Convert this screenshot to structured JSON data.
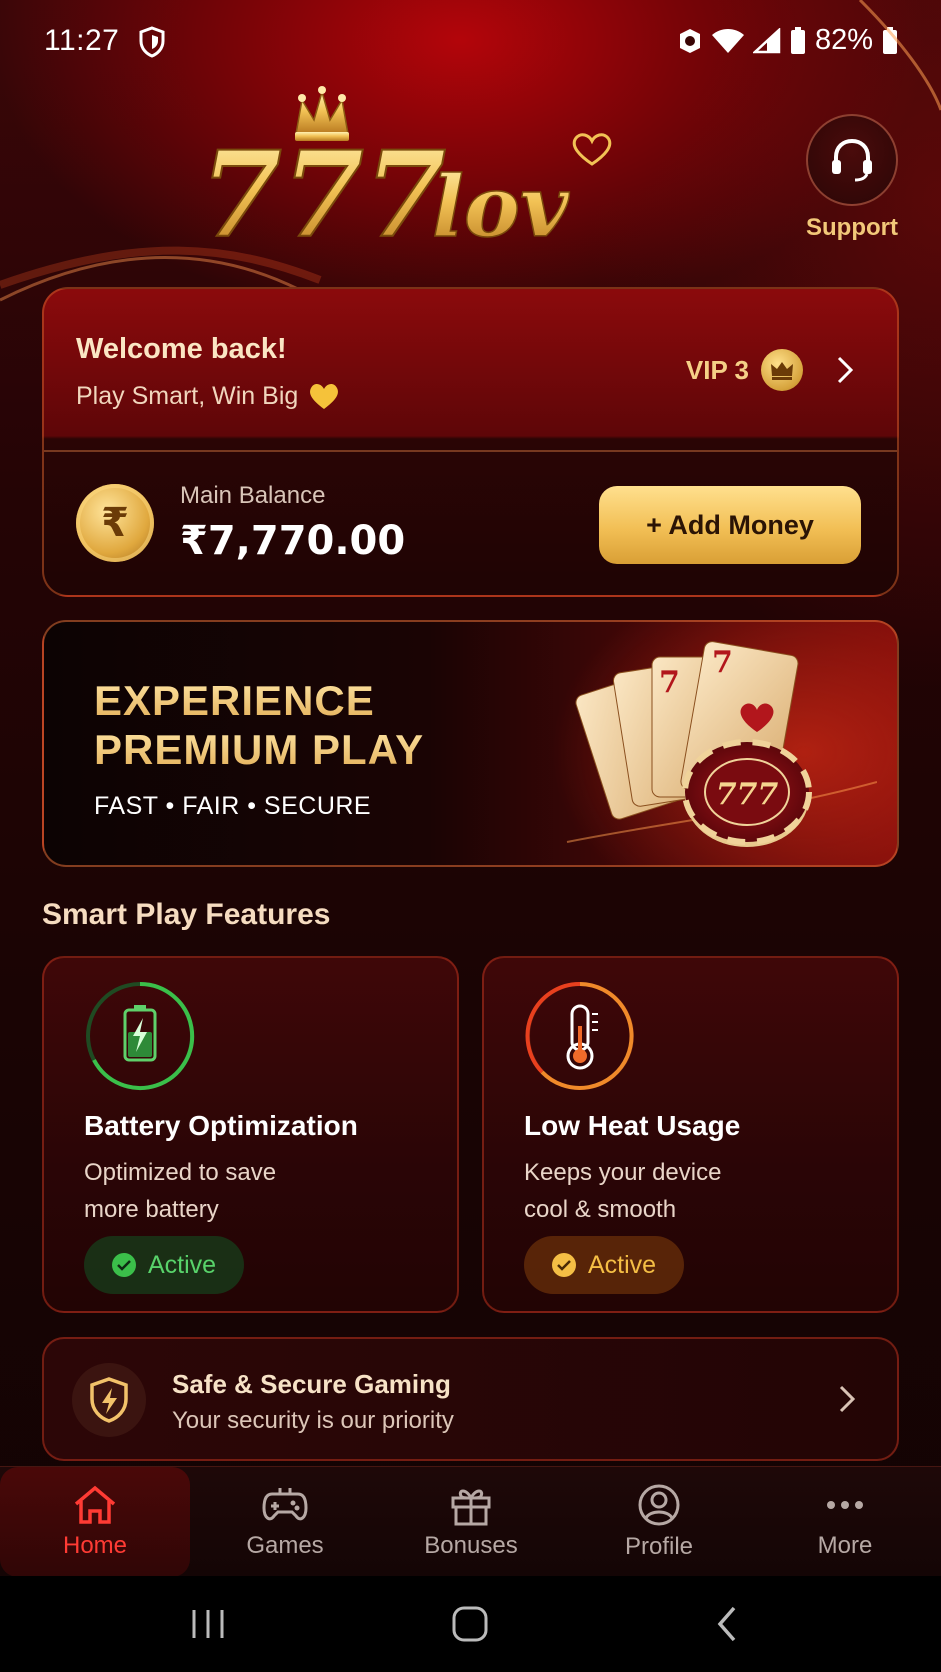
{
  "status_bar": {
    "time": "11:27",
    "battery": "82%"
  },
  "brand": {
    "logo_numbers": "777",
    "logo_word": "lov"
  },
  "support": {
    "label": "Support"
  },
  "welcome": {
    "title": "Welcome back!",
    "subtitle": "Play Smart, Win Big",
    "vip_label": "VIP 3"
  },
  "balance": {
    "label": "Main Balance",
    "value": "₹7,770.00",
    "currency_symbol": "₹",
    "add_money_label": "+ Add Money"
  },
  "banner": {
    "line1": "EXPERIENCE",
    "line2": "PREMIUM PLAY",
    "tagline": "FAST • FAIR • SECURE",
    "chip_text": "777"
  },
  "features": {
    "section_title": "Smart Play Features",
    "items": [
      {
        "title": "Battery Optimization",
        "desc_line1": "Optimized to save",
        "desc_line2": "more battery",
        "status": "Active",
        "icon": "battery-icon"
      },
      {
        "title": "Low Heat Usage",
        "desc_line1": "Keeps your device",
        "desc_line2": "cool & smooth",
        "status": "Active",
        "icon": "thermometer-icon"
      }
    ]
  },
  "secure": {
    "title": "Safe & Secure Gaming",
    "subtitle": "Your security is our priority"
  },
  "bottom_nav": {
    "items": [
      {
        "label": "Home",
        "icon": "home-icon",
        "active": true
      },
      {
        "label": "Games",
        "icon": "gamepad-icon",
        "active": false
      },
      {
        "label": "Bonuses",
        "icon": "gift-icon",
        "active": false
      },
      {
        "label": "Profile",
        "icon": "profile-icon",
        "active": false
      },
      {
        "label": "More",
        "icon": "more-icon",
        "active": false
      }
    ]
  },
  "colors": {
    "accent_gold": "#f2c26a",
    "active_red": "#ff3b34",
    "status_green": "#58d26a",
    "status_gold": "#f4be45",
    "background": "#1a0404"
  }
}
